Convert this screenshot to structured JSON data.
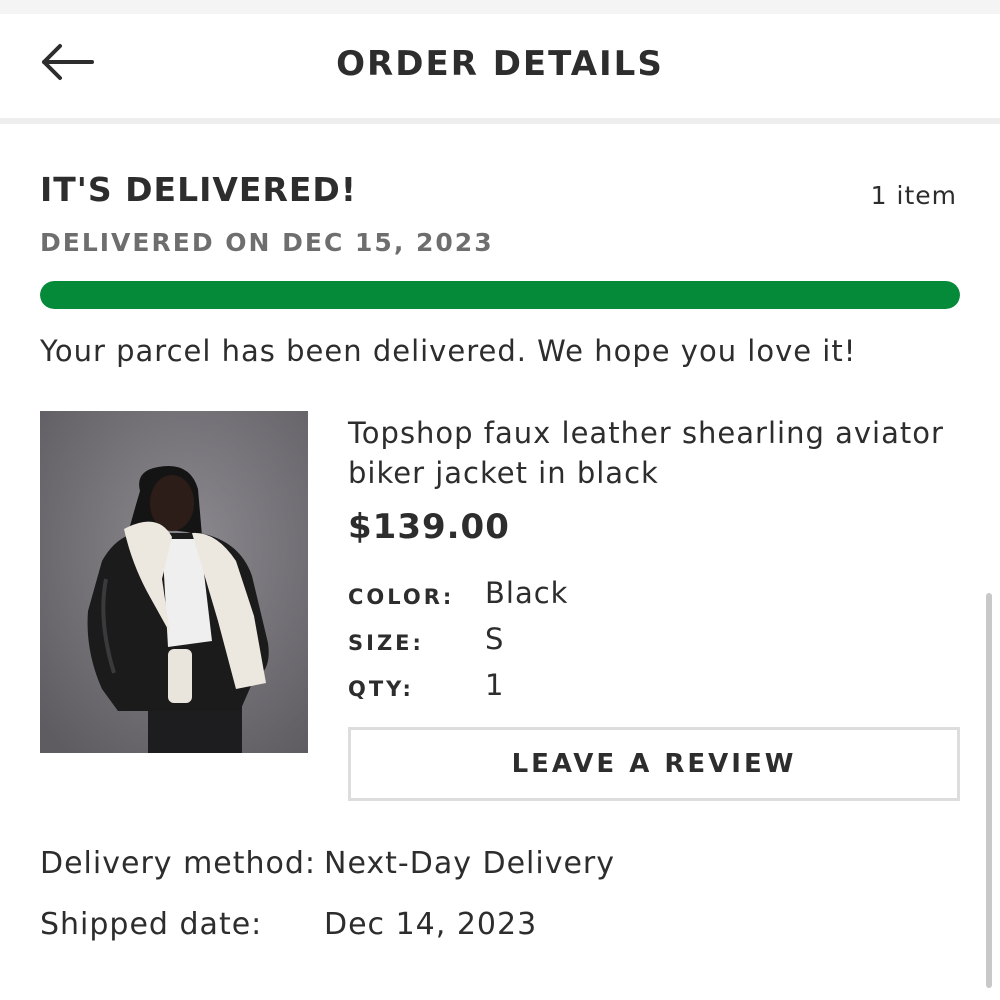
{
  "header": {
    "title": "ORDER DETAILS",
    "back_icon": "arrow-left-icon"
  },
  "status": {
    "title": "IT'S DELIVERED!",
    "item_count": "1 item",
    "delivered_on": "DELIVERED ON DEC 15, 2023",
    "progress_percent": 100,
    "progress_color": "#058a3a",
    "message": "Your parcel has been delivered. We hope you love it!"
  },
  "product": {
    "name_line1": "Topshop faux leather shearling aviator",
    "name_line2": "biker jacket in black",
    "price": "$139.00",
    "color_label": "COLOR:",
    "color_value": "Black",
    "size_label": "SIZE:",
    "size_value": "S",
    "qty_label": "QTY:",
    "qty_value": "1",
    "review_button_label": "LEAVE A REVIEW"
  },
  "shipping": {
    "method_label": "Delivery method:",
    "method_value": "Next-Day Delivery",
    "shipped_label": "Shipped date:",
    "shipped_value": "Dec 14, 2023"
  }
}
